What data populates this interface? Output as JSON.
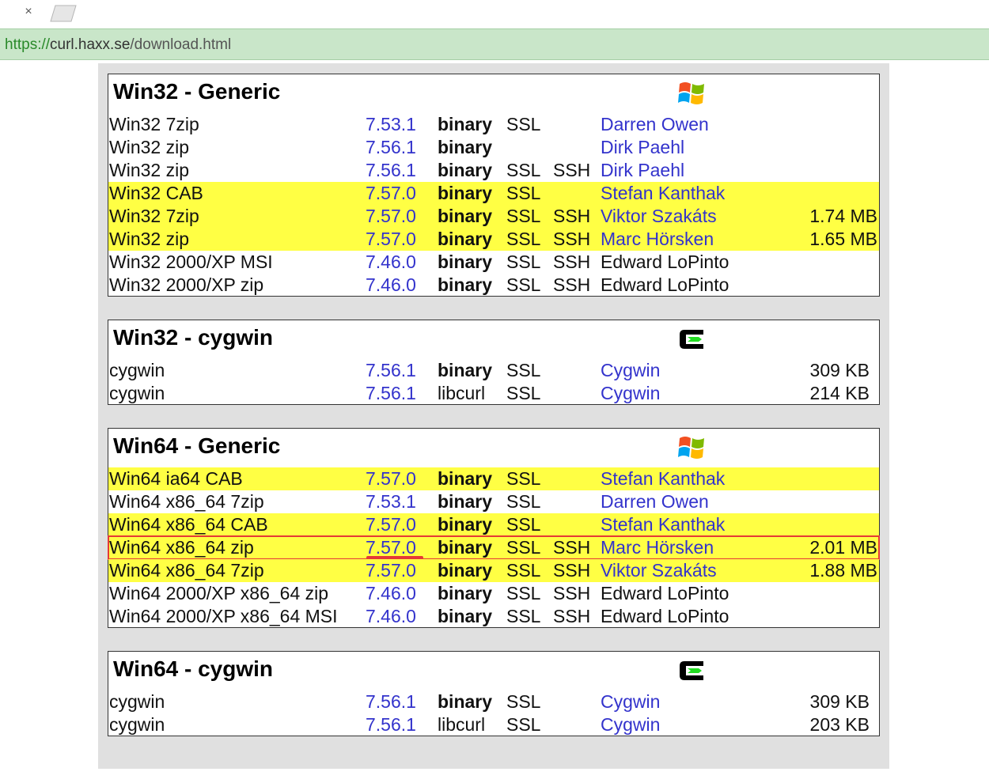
{
  "browser": {
    "close_symbol": "×",
    "url_scheme": "https://",
    "url_host": "curl.haxx.se",
    "url_path": "/download.html"
  },
  "sections": [
    {
      "title": "Win32 - Generic",
      "icon": "windows-logo-icon",
      "rows": [
        {
          "name": "Win32 7zip",
          "version": "7.53.1",
          "type": "binary",
          "ssl": "SSL",
          "ssh": "",
          "provider": "Darren Owen",
          "size": ""
        },
        {
          "name": "Win32 zip",
          "version": "7.56.1",
          "type": "binary",
          "ssl": "",
          "ssh": "",
          "provider": "Dirk Paehl",
          "size": ""
        },
        {
          "name": "Win32 zip",
          "version": "7.56.1",
          "type": "binary",
          "ssl": "SSL",
          "ssh": "SSH",
          "provider": "Dirk Paehl",
          "size": ""
        },
        {
          "name": "Win32 CAB",
          "version": "7.57.0",
          "type": "binary",
          "ssl": "SSL",
          "ssh": "",
          "provider": "Stefan Kanthak",
          "size": ""
        },
        {
          "name": "Win32 7zip",
          "version": "7.57.0",
          "type": "binary",
          "ssl": "SSL",
          "ssh": "SSH",
          "provider": "Viktor Szakáts",
          "size": "1.74 MB"
        },
        {
          "name": "Win32 zip",
          "version": "7.57.0",
          "type": "binary",
          "ssl": "SSL",
          "ssh": "SSH",
          "provider": "Marc Hörsken",
          "size": "1.65 MB"
        },
        {
          "name": "Win32 2000/XP MSI",
          "version": "7.46.0",
          "type": "binary",
          "ssl": "SSL",
          "ssh": "SSH",
          "provider": "Edward LoPinto",
          "size": ""
        },
        {
          "name": "Win32 2000/XP zip",
          "version": "7.46.0",
          "type": "binary",
          "ssl": "SSL",
          "ssh": "SSH",
          "provider": "Edward LoPinto",
          "size": ""
        }
      ]
    },
    {
      "title": "Win32 - cygwin",
      "icon": "cygwin-logo-icon",
      "rows": [
        {
          "name": "cygwin",
          "version": "7.56.1",
          "type": "binary",
          "ssl": "SSL",
          "ssh": "",
          "provider": "Cygwin",
          "size": "309 KB"
        },
        {
          "name": "cygwin",
          "version": "7.56.1",
          "type": "libcurl",
          "ssl": "SSL",
          "ssh": "",
          "provider": "Cygwin",
          "size": "214 KB"
        }
      ]
    },
    {
      "title": "Win64 - Generic",
      "icon": "windows-logo-icon",
      "rows": [
        {
          "name": "Win64 ia64 CAB",
          "version": "7.57.0",
          "type": "binary",
          "ssl": "SSL",
          "ssh": "",
          "provider": "Stefan Kanthak",
          "size": ""
        },
        {
          "name": "Win64 x86_64 7zip",
          "version": "7.53.1",
          "type": "binary",
          "ssl": "SSL",
          "ssh": "",
          "provider": "Darren Owen",
          "size": ""
        },
        {
          "name": "Win64 x86_64 CAB",
          "version": "7.57.0",
          "type": "binary",
          "ssl": "SSL",
          "ssh": "",
          "provider": "Stefan Kanthak",
          "size": ""
        },
        {
          "name": "Win64 x86_64 zip",
          "version": "7.57.0",
          "type": "binary",
          "ssl": "SSL",
          "ssh": "SSH",
          "provider": "Marc Hörsken",
          "size": "2.01 MB"
        },
        {
          "name": "Win64 x86_64 7zip",
          "version": "7.57.0",
          "type": "binary",
          "ssl": "SSL",
          "ssh": "SSH",
          "provider": "Viktor Szakáts",
          "size": "1.88 MB"
        },
        {
          "name": "Win64 2000/XP x86_64 zip",
          "version": "7.46.0",
          "type": "binary",
          "ssl": "SSL",
          "ssh": "SSH",
          "provider": "Edward LoPinto",
          "size": ""
        },
        {
          "name": "Win64 2000/XP x86_64 MSI",
          "version": "7.46.0",
          "type": "binary",
          "ssl": "SSL",
          "ssh": "SSH",
          "provider": "Edward LoPinto",
          "size": ""
        }
      ]
    },
    {
      "title": "Win64 - cygwin",
      "icon": "cygwin-logo-icon",
      "rows": [
        {
          "name": "cygwin",
          "version": "7.56.1",
          "type": "binary",
          "ssl": "SSL",
          "ssh": "",
          "provider": "Cygwin",
          "size": "309 KB"
        },
        {
          "name": "cygwin",
          "version": "7.56.1",
          "type": "libcurl",
          "ssl": "SSL",
          "ssh": "",
          "provider": "Cygwin",
          "size": "203 KB"
        }
      ]
    }
  ],
  "colors": {
    "highlight": "#ffff44",
    "link": "#3333cc",
    "annotation": "#e53935",
    "address_bar": "#c9e6c9"
  }
}
